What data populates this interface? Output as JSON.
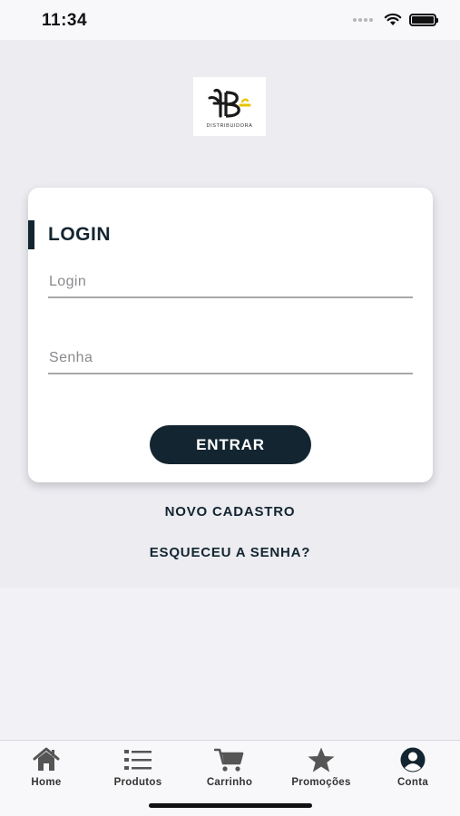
{
  "status_bar": {
    "time": "11:34"
  },
  "logo": {
    "caption": "DISTRIBUIDORA",
    "mark_text": "FB"
  },
  "login_card": {
    "title": "LOGIN",
    "login_placeholder": "Login",
    "password_placeholder": "Senha",
    "enter_label": "ENTRAR"
  },
  "links": {
    "new_account": "NOVO CADASTRO",
    "forgot_password": "ESQUECEU A SENHA?"
  },
  "tab_bar": {
    "items": [
      {
        "label": "Home",
        "icon": "home-icon"
      },
      {
        "label": "Produtos",
        "icon": "list-icon"
      },
      {
        "label": "Carrinho",
        "icon": "cart-icon"
      },
      {
        "label": "Promoções",
        "icon": "star-icon"
      },
      {
        "label": "Conta",
        "icon": "account-icon"
      }
    ]
  },
  "colors": {
    "primary": "#132530",
    "logo_accent": "#e8c400"
  }
}
